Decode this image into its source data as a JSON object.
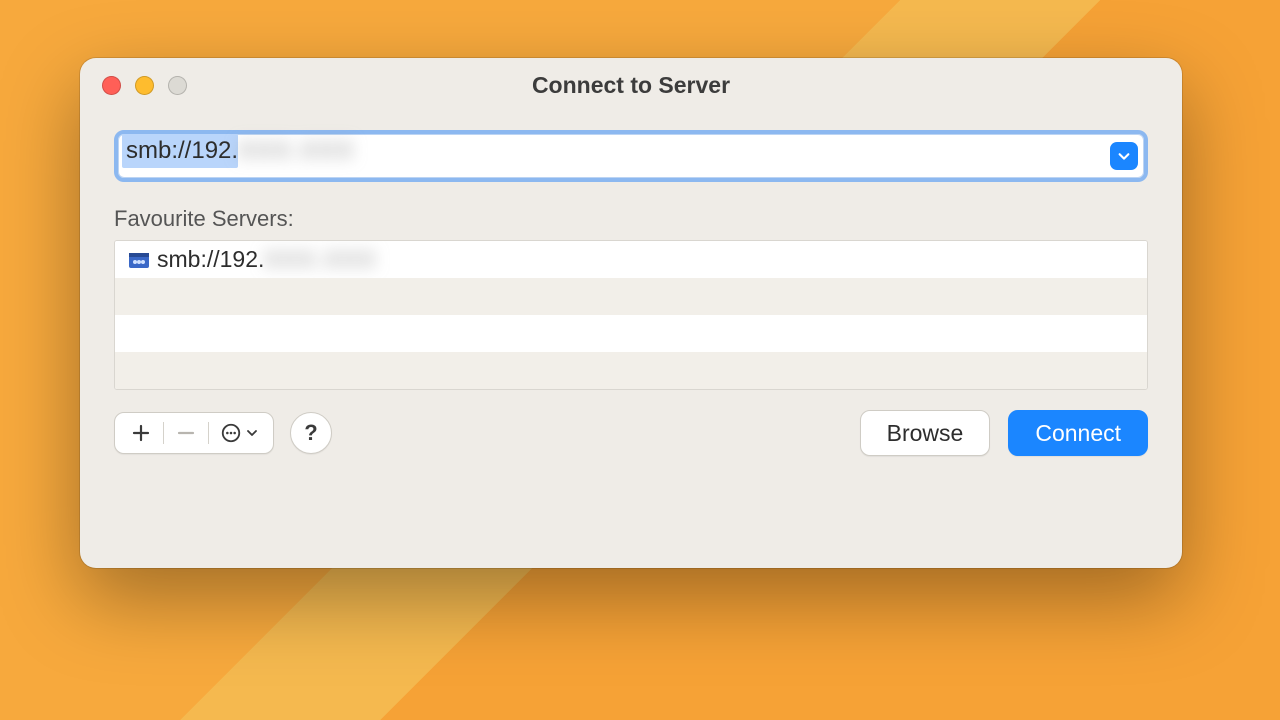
{
  "window": {
    "title": "Connect to Server"
  },
  "address": {
    "value_visible": "smb://192.",
    "value_obscured": "XXX.XXX"
  },
  "sections": {
    "favourites_label": "Favourite Servers:"
  },
  "favourites": [
    {
      "visible": "smb://192.",
      "obscured": "XXX.XXX"
    }
  ],
  "buttons": {
    "browse": "Browse",
    "connect": "Connect",
    "help": "?"
  },
  "icons": {
    "add": "plus-icon",
    "remove": "minus-icon",
    "actions": "ellipsis-icon",
    "dropdown": "chevron-down-icon",
    "server": "network-server-icon",
    "history": "chevron-down-icon"
  },
  "colors": {
    "accent": "#1b86ff",
    "window_bg": "#efece7",
    "desktop": "#f7a93d"
  }
}
